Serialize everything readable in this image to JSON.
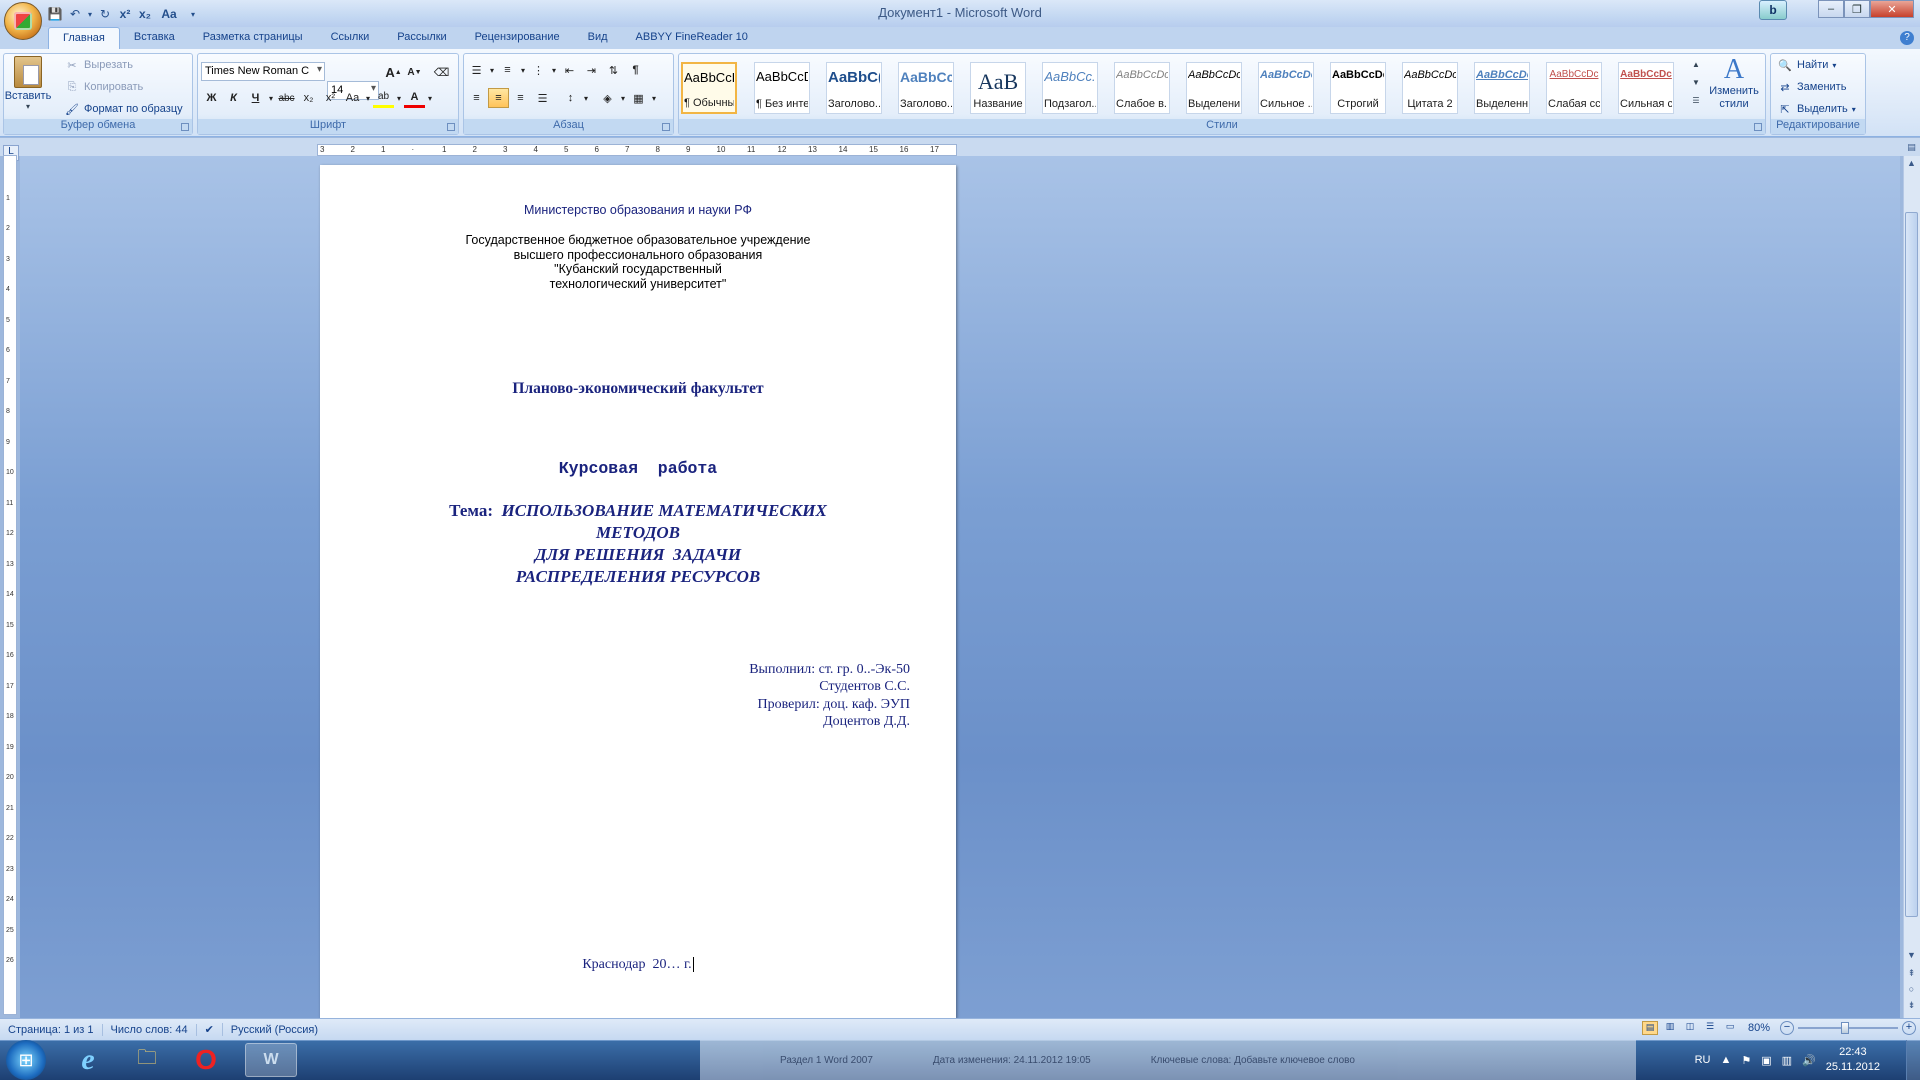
{
  "window": {
    "title": "Документ1 - Microsoft Word"
  },
  "qat": {
    "font_btn": "Aa"
  },
  "tabs": [
    "Главная",
    "Вставка",
    "Разметка страницы",
    "Ссылки",
    "Рассылки",
    "Рецензирование",
    "Вид",
    "ABBYY FineReader 10"
  ],
  "clipboard": {
    "paste": "Вставить",
    "cut": "Вырезать",
    "copy": "Копировать",
    "format_painter": "Формат по образцу",
    "label": "Буфер обмена"
  },
  "font": {
    "name": "Times New Roman C",
    "size": "14",
    "label": "Шрифт",
    "bold": "Ж",
    "italic": "К",
    "underline": "Ч",
    "strike": "abc",
    "sub": "x₂",
    "sup": "x²",
    "case": "Aa",
    "grow": "A",
    "shrink": "A",
    "color_letter": "A"
  },
  "paragraph": {
    "label": "Абзац",
    "pilcrow": "¶"
  },
  "styles": {
    "label": "Стили",
    "items": [
      {
        "sample": "AaBbCcDc",
        "name": "¶ Обычный"
      },
      {
        "sample": "AaBbCcDc",
        "name": "¶ Без инте..."
      },
      {
        "sample": "AaBbC(",
        "name": "Заголово..."
      },
      {
        "sample": "AaBbCc",
        "name": "Заголово..."
      },
      {
        "sample": "AaB",
        "name": "Название"
      },
      {
        "sample": "AaBbCc.",
        "name": "Подзагол..."
      },
      {
        "sample": "AaBbCcDc",
        "name": "Слабое в..."
      },
      {
        "sample": "AaBbCcDc",
        "name": "Выделение"
      },
      {
        "sample": "AaBbCcDc",
        "name": "Сильное ..."
      },
      {
        "sample": "AaBbCcDc",
        "name": "Строгий"
      },
      {
        "sample": "AaBbCcDc",
        "name": "Цитата 2"
      },
      {
        "sample": "AaBbCcDc",
        "name": "Выделенн..."
      },
      {
        "sample": "AaBbCcDc",
        "name": "Слабая сс..."
      },
      {
        "sample": "AaBbCcDc",
        "name": "Сильная с..."
      }
    ],
    "change": "Изменить стили"
  },
  "editing": {
    "find": "Найти",
    "replace": "Заменить",
    "select": "Выделить",
    "label": "Редактирование"
  },
  "document": {
    "ministry": "Министерство образования и науки РФ",
    "inst1": "Государственное бюджетное образовательное учреждение",
    "inst2": "высшего профессионального образования",
    "inst3": "\"Кубанский государственный",
    "inst4": "технологический университет\"",
    "faculty": "Планово-экономический факультет",
    "work": "Курсовая  работа",
    "topic_prefix": "Тема:",
    "topic1": "ИСПОЛЬЗОВАНИЕ МАТЕМАТИЧЕСКИХ",
    "topic2": "МЕТОДОВ",
    "topic3": "ДЛЯ РЕШЕНИЯ  ЗАДАЧИ",
    "topic4": "РАСПРЕДЕЛЕНИЯ РЕСУРСОВ",
    "done_by": "Выполнил: ст. гр. 0..-Эк-50",
    "student": "Студентов С.С.",
    "checked_by": "Проверил: доц. каф. ЭУП",
    "teacher": "Доцентов Д.Д.",
    "city": "Краснодар  20… г."
  },
  "status": {
    "page": "Страница: 1 из 1",
    "words": "Число слов: 44",
    "lang": "Русский (Россия)",
    "zoom": "80%"
  },
  "tray": {
    "lang": "RU",
    "time": "22:43",
    "date": "25.11.2012"
  },
  "taskbar_preview": {
    "item1": "Раздел 1 Word 2007",
    "item2": "Дата изменения: 24.11.2012 19:05",
    "item3": "Ключевые слова: Добавьте ключевое слово"
  }
}
